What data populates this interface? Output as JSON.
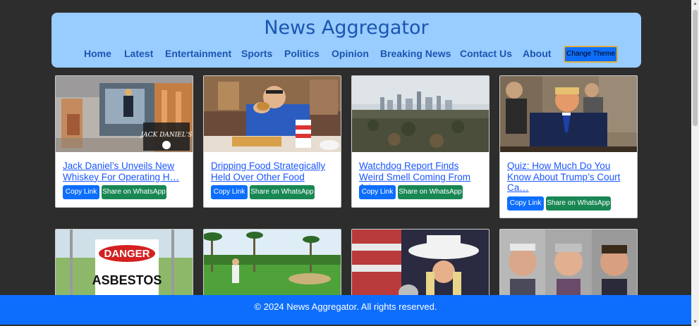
{
  "site": {
    "title": "News Aggregator"
  },
  "nav": {
    "items": [
      "Home",
      "Latest",
      "Entertainment",
      "Sports",
      "Politics",
      "Opinion",
      "Breaking News",
      "Contact Us",
      "About"
    ],
    "theme_button": "Change Theme"
  },
  "cards": [
    {
      "title": "Jack Daniel’s Unveils New Whiskey For Operating H…",
      "copy": "Copy Link",
      "share": "Share on WhatsApp"
    },
    {
      "title": "Dripping Food Strategically Held Over Other Food",
      "copy": "Copy Link",
      "share": "Share on WhatsApp"
    },
    {
      "title": "Watchdog Report Finds Weird Smell Coming From Ari…",
      "copy": "Copy Link",
      "share": "Share on WhatsApp"
    },
    {
      "title": "Quiz: How Much Do You Know About Trump’s Court Ca…",
      "copy": "Copy Link",
      "share": "Share on WhatsApp"
    }
  ],
  "second_row": {
    "danger_sign": "DANGER",
    "asbestos_sign": "ASBESTOS",
    "whiskey_logo": "JACK DANIEL'S"
  },
  "footer": {
    "text": "© 2024 News Aggregator. All rights reserved."
  },
  "colors": {
    "header_bg": "#99ccff",
    "nav_text": "#1a56b0",
    "page_bg": "#2d2d2d",
    "footer_bg": "#0d6efd",
    "copy_btn": "#0d6efd",
    "whatsapp_btn": "#198754"
  }
}
